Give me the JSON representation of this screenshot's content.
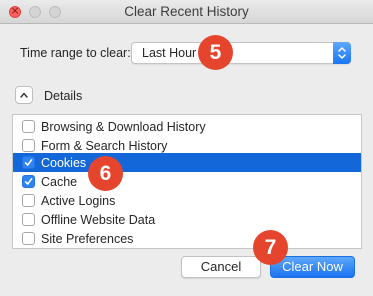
{
  "window": {
    "title": "Clear Recent History"
  },
  "time_range": {
    "label": "Time range to clear:",
    "selected": "Last Hour"
  },
  "details": {
    "label": "Details",
    "expanded": true
  },
  "items": [
    {
      "label": "Browsing & Download History",
      "checked": false,
      "selected": false
    },
    {
      "label": "Form & Search History",
      "checked": false,
      "selected": false
    },
    {
      "label": "Cookies",
      "checked": true,
      "selected": true
    },
    {
      "label": "Cache",
      "checked": true,
      "selected": false
    },
    {
      "label": "Active Logins",
      "checked": false,
      "selected": false
    },
    {
      "label": "Offline Website Data",
      "checked": false,
      "selected": false
    },
    {
      "label": "Site Preferences",
      "checked": false,
      "selected": false
    }
  ],
  "buttons": {
    "cancel": "Cancel",
    "clear_now": "Clear Now"
  },
  "annotations": {
    "step5": "5",
    "step6": "6",
    "step7": "7"
  },
  "colors": {
    "accent": "#1b76f4",
    "selection": "#1467d8",
    "badge": "#e5452c",
    "close_button": "#fc605c"
  }
}
